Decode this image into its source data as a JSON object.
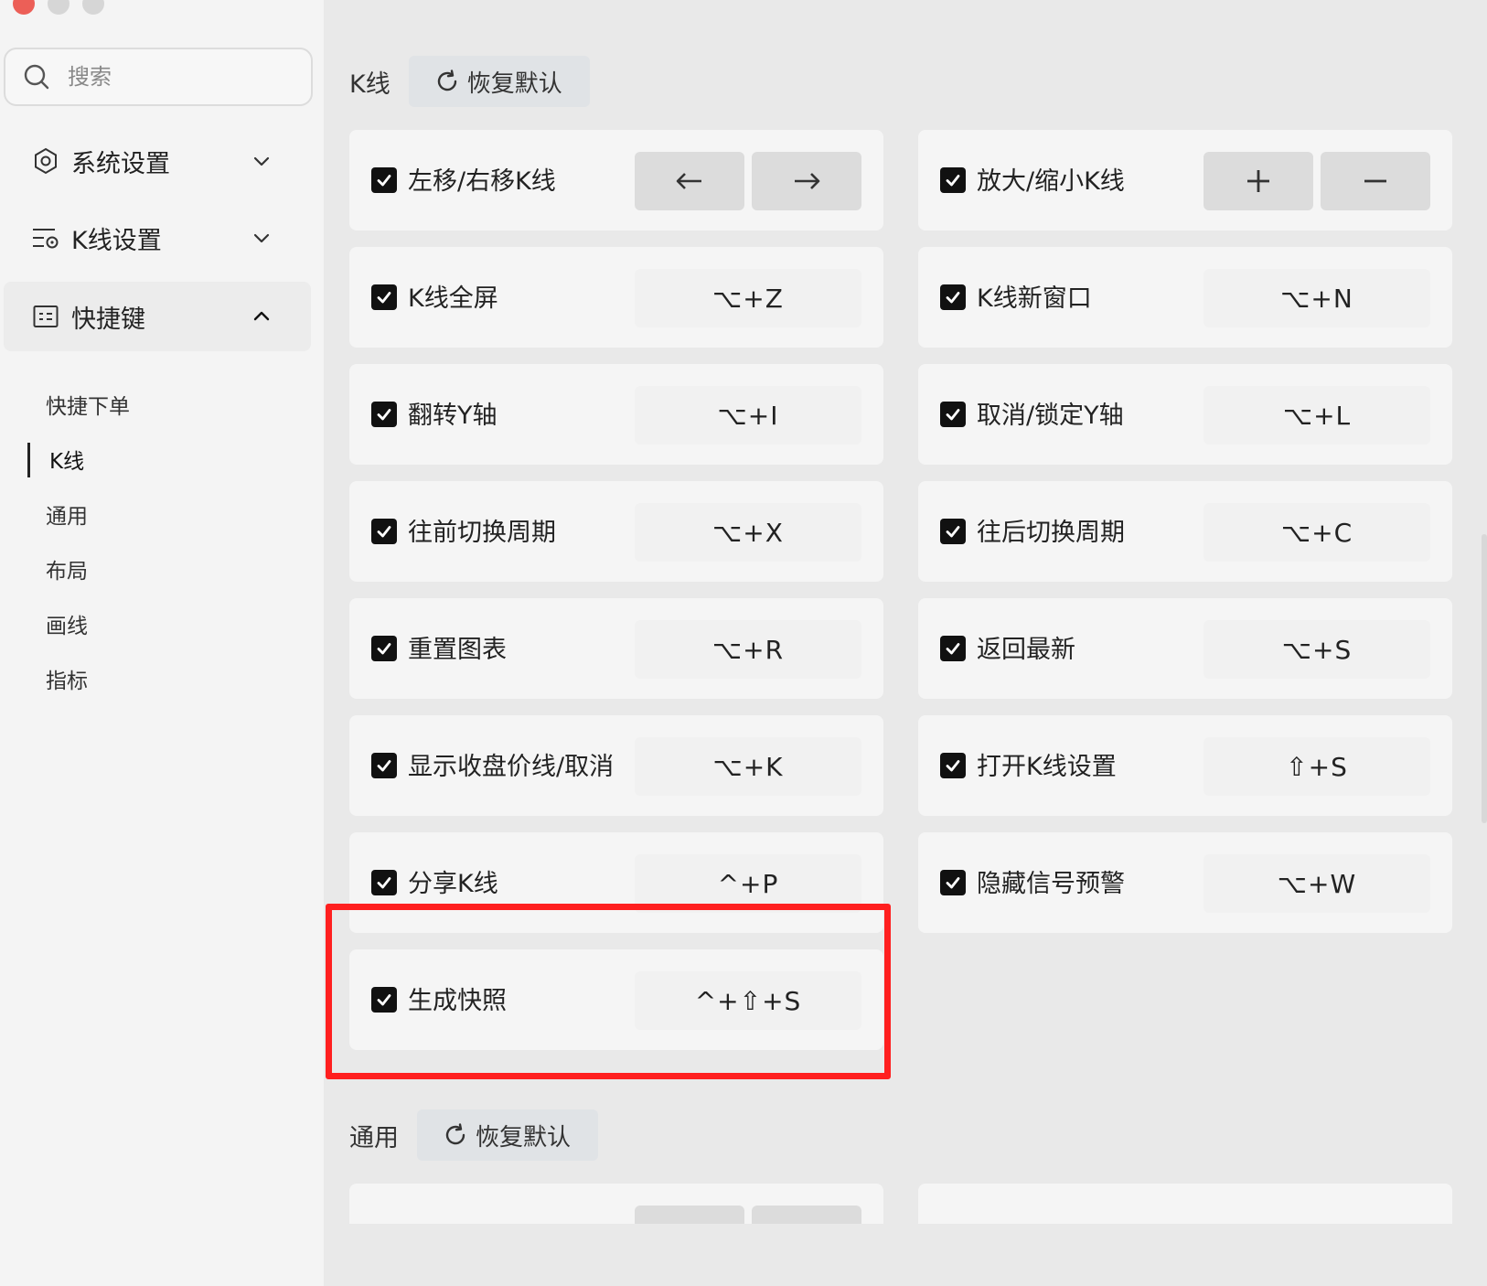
{
  "sidebar": {
    "search_placeholder": "搜索",
    "groups": [
      {
        "label": "系统设置",
        "icon": "gear-icon",
        "expanded": false
      },
      {
        "label": "K线设置",
        "icon": "kline-settings-icon",
        "expanded": false
      },
      {
        "label": "快捷键",
        "icon": "shortcut-keyboard-icon",
        "expanded": true
      }
    ],
    "subitems": [
      {
        "label": "快捷下单",
        "active": false
      },
      {
        "label": "K线",
        "active": true
      },
      {
        "label": "通用",
        "active": false
      },
      {
        "label": "布局",
        "active": false
      },
      {
        "label": "画线",
        "active": false
      },
      {
        "label": "指标",
        "active": false
      }
    ]
  },
  "sections": {
    "kline": {
      "title": "K线",
      "reset_label": "恢复默认"
    },
    "general": {
      "title": "通用",
      "reset_label": "恢复默认"
    }
  },
  "shortcuts": [
    {
      "label": "左移/右移K线",
      "checked": true,
      "keys": [
        "arrow-left-icon",
        "arrow-right-icon"
      ]
    },
    {
      "label": "放大/缩小K线",
      "checked": true,
      "keys": [
        "plus-icon",
        "minus-icon"
      ]
    },
    {
      "label": "K线全屏",
      "checked": true,
      "key": "⌥+Z"
    },
    {
      "label": "K线新窗口",
      "checked": true,
      "key": "⌥+N"
    },
    {
      "label": "翻转Y轴",
      "checked": true,
      "key": "⌥+I"
    },
    {
      "label": "取消/锁定Y轴",
      "checked": true,
      "key": "⌥+L"
    },
    {
      "label": "往前切换周期",
      "checked": true,
      "key": "⌥+X"
    },
    {
      "label": "往后切换周期",
      "checked": true,
      "key": "⌥+C"
    },
    {
      "label": "重置图表",
      "checked": true,
      "key": "⌥+R"
    },
    {
      "label": "返回最新",
      "checked": true,
      "key": "⌥+S"
    },
    {
      "label": "显示收盘价线/取消",
      "checked": true,
      "key": "⌥+K"
    },
    {
      "label": "打开K线设置",
      "checked": true,
      "key": "⇧+S"
    },
    {
      "label": "分享K线",
      "checked": true,
      "key": "^+P"
    },
    {
      "label": "隐藏信号预警",
      "checked": true,
      "key": "⌥+W"
    },
    {
      "label": "生成快照",
      "checked": true,
      "key": "^+⇧+S",
      "highlighted": true
    }
  ],
  "colors": {
    "highlight_border": "#ff1f1f",
    "checkbox": "#111111",
    "card_bg": "#f5f5f5",
    "page_bg": "#e9e9e9"
  }
}
